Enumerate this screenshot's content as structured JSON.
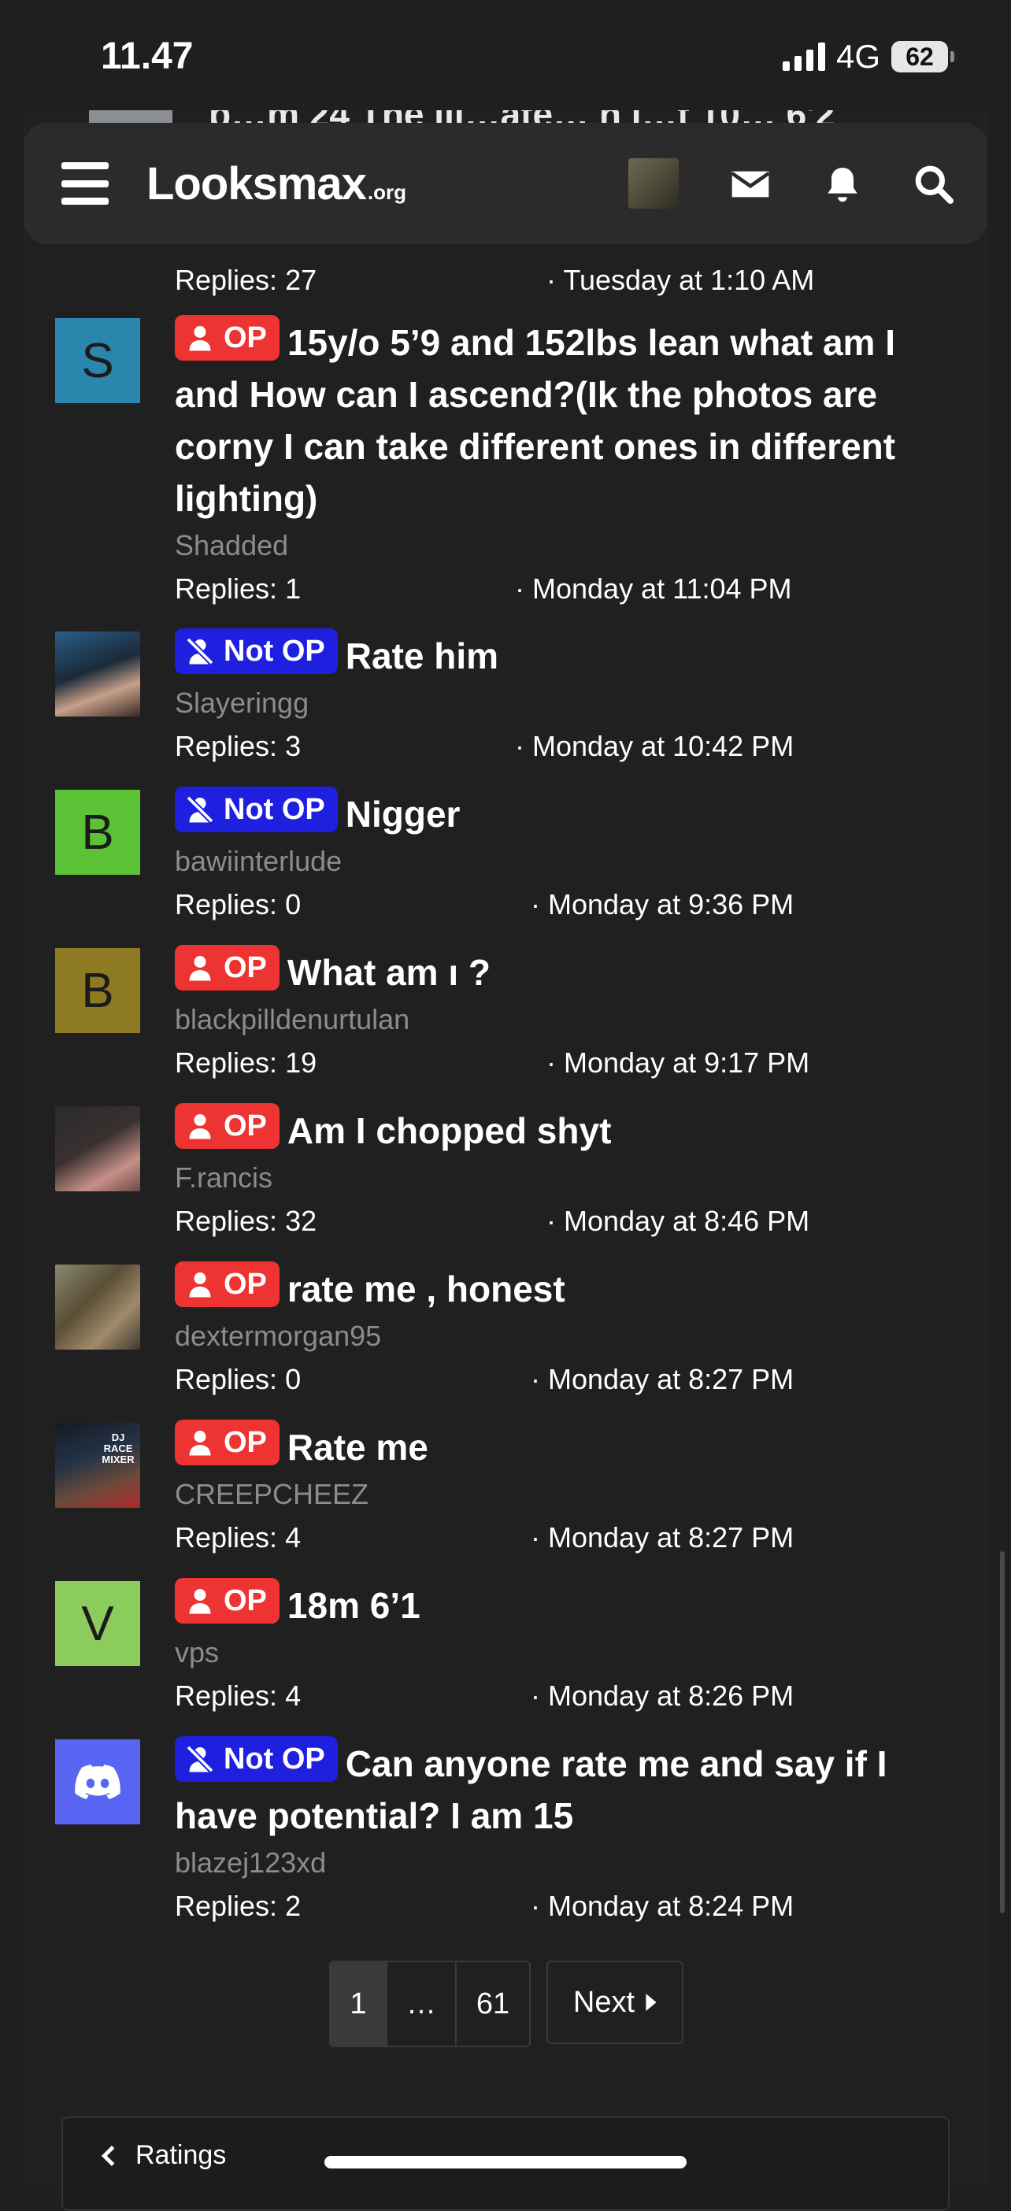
{
  "status": {
    "time": "11.47",
    "network": "4G",
    "battery": "62"
  },
  "nav": {
    "logo_main": "Looksmax",
    "logo_suffix": ".org"
  },
  "peek": {
    "text": "b…m 24 The lli…ate… h l…t 10… 6'2"
  },
  "first_meta": {
    "replies": "Replies: 27",
    "date": "· Tuesday at 1:10 AM"
  },
  "threads": [
    {
      "avatar_letter": "S",
      "avatar_color": "#2a86ad",
      "badge": "OP",
      "badge_type": "op",
      "title": "15y/o 5’9 and 152lbs lean what am I and How can I ascend?(Ik the photos are corny I can take different ones in different lighting)",
      "author": "Shadded",
      "replies": "Replies: 1",
      "date": "· Monday at 11:04 PM"
    },
    {
      "avatar_letter": "",
      "avatar_color": "#3a4a58",
      "badge": "Not OP",
      "badge_type": "notop",
      "title": "Rate him",
      "author": "Slayeringg",
      "replies": "Replies: 3",
      "date": "· Monday at 10:42 PM"
    },
    {
      "avatar_letter": "B",
      "avatar_color": "#5bc236",
      "badge": "Not OP",
      "badge_type": "notop",
      "title": "Nigger",
      "author": "bawiinterlude",
      "replies": "Replies: 0",
      "date": "· Monday at 9:36 PM"
    },
    {
      "avatar_letter": "B",
      "avatar_color": "#8e7a22",
      "badge": "OP",
      "badge_type": "op",
      "title": "What am ı ?",
      "author": "blackpilldenurtulan",
      "replies": "Replies: 19",
      "date": "· Monday at 9:17 PM"
    },
    {
      "avatar_letter": "",
      "avatar_color": "#5a3a38",
      "badge": "OP",
      "badge_type": "op",
      "title": "Am I chopped shyt",
      "author": "F.rancis",
      "replies": "Replies: 32",
      "date": "· Monday at 8:46 PM"
    },
    {
      "avatar_letter": "",
      "avatar_color": "#6b6248",
      "badge": "OP",
      "badge_type": "op",
      "title": "rate me , honest",
      "author": "dextermorgan95",
      "replies": "Replies: 0",
      "date": "· Monday at 8:27 PM"
    },
    {
      "avatar_letter": "",
      "avatar_color": "#263040",
      "badge": "OP",
      "badge_type": "op",
      "title": "Rate me",
      "author": "CREEPCHEEZ",
      "replies": "Replies: 4",
      "date": "· Monday at 8:27 PM",
      "avatar_caption": "DJ RACE MIXER"
    },
    {
      "avatar_letter": "V",
      "avatar_color": "#8ccc5c",
      "badge": "OP",
      "badge_type": "op",
      "title": "18m 6’1",
      "author": "vps",
      "replies": "Replies: 4",
      "date": "· Monday at 8:26 PM"
    },
    {
      "avatar_letter": "",
      "avatar_color": "#5865f2",
      "badge": "Not OP",
      "badge_type": "notop",
      "title": "Can anyone rate me and say if I have potential? I am 15",
      "author": "blazej123xd",
      "replies": "Replies: 2",
      "date": "· Monday at 8:24 PM"
    }
  ],
  "pagination": {
    "current": "1",
    "ellipsis": "…",
    "last": "61",
    "next": "Next"
  },
  "breadcrumb": {
    "label": "Ratings"
  }
}
